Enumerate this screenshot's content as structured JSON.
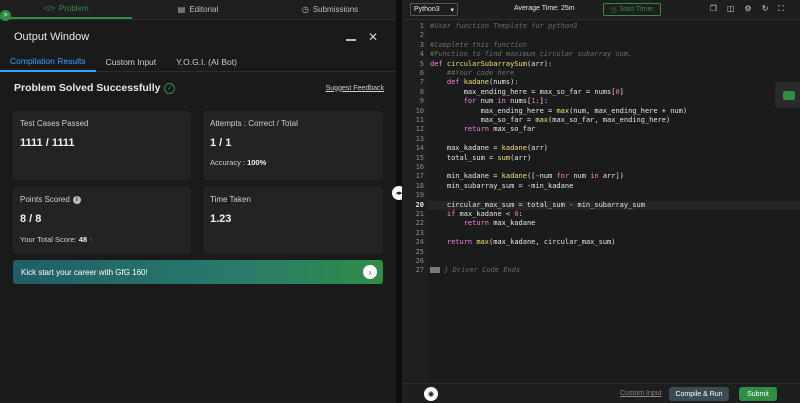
{
  "top_tabs": [
    {
      "label": "Problem",
      "icon": "code-icon"
    },
    {
      "label": "Editorial",
      "icon": "document-icon"
    },
    {
      "label": "Submissions",
      "icon": "history-icon"
    }
  ],
  "output": {
    "title": "Output Window",
    "tabs": [
      "Compilation Results",
      "Custom Input",
      "Y.O.G.I. (AI Bot)"
    ],
    "status": "Problem Solved Successfully",
    "feedback": "Suggest Feedback",
    "cards": {
      "test_cases": {
        "label": "Test Cases Passed",
        "value": "1111 / 1111"
      },
      "attempts": {
        "label": "Attempts : Correct / Total",
        "value": "1 / 1",
        "accuracy_label": "Accuracy : ",
        "accuracy": "100%"
      },
      "points": {
        "label": "Points Scored",
        "value": "8 / 8",
        "total_label": "Your Total Score: ",
        "total": "48"
      },
      "time": {
        "label": "Time Taken",
        "value": "1.23"
      }
    },
    "promo": "Kick start your career with GfG 160!"
  },
  "editor_toolbar": {
    "language": "Python3",
    "avg_time": "Average Time: 25m",
    "timer": "Start Timer"
  },
  "code_lines": [
    "#User function Template for python3",
    "",
    "#Complete this function",
    "#Function to find maximum circular subarray sum.",
    "def circularSubarraySum(arr):",
    "    ##Your code here",
    "    def kadane(nums):",
    "        max_ending_here = max_so_far = nums[0]",
    "        for num in nums[1:]:",
    "            max_ending_here = max(num, max_ending_here + num)",
    "            max_so_far = max(max_so_far, max_ending_here)",
    "        return max_so_far",
    "",
    "    max_kadane = kadane(arr)",
    "    total_sum = sum(arr)",
    "",
    "    min_kadane = kadane([-num for num in arr])",
    "    min_subarray_sum = -min_kadane",
    "",
    "    circular_max_sum = total_sum - min_subarray_sum",
    "    if max_kadane < 0:",
    "        return max_kadane",
    "",
    "    return max(max_kadane, circular_max_sum)",
    "",
    "",
    "} Driver Code Ends"
  ],
  "bottom": {
    "custom_input": "Custom Input",
    "compile": "Compile & Run",
    "submit": "Submit"
  },
  "colors": {
    "accent": "#2f8d46",
    "link": "#3aa0ff"
  }
}
